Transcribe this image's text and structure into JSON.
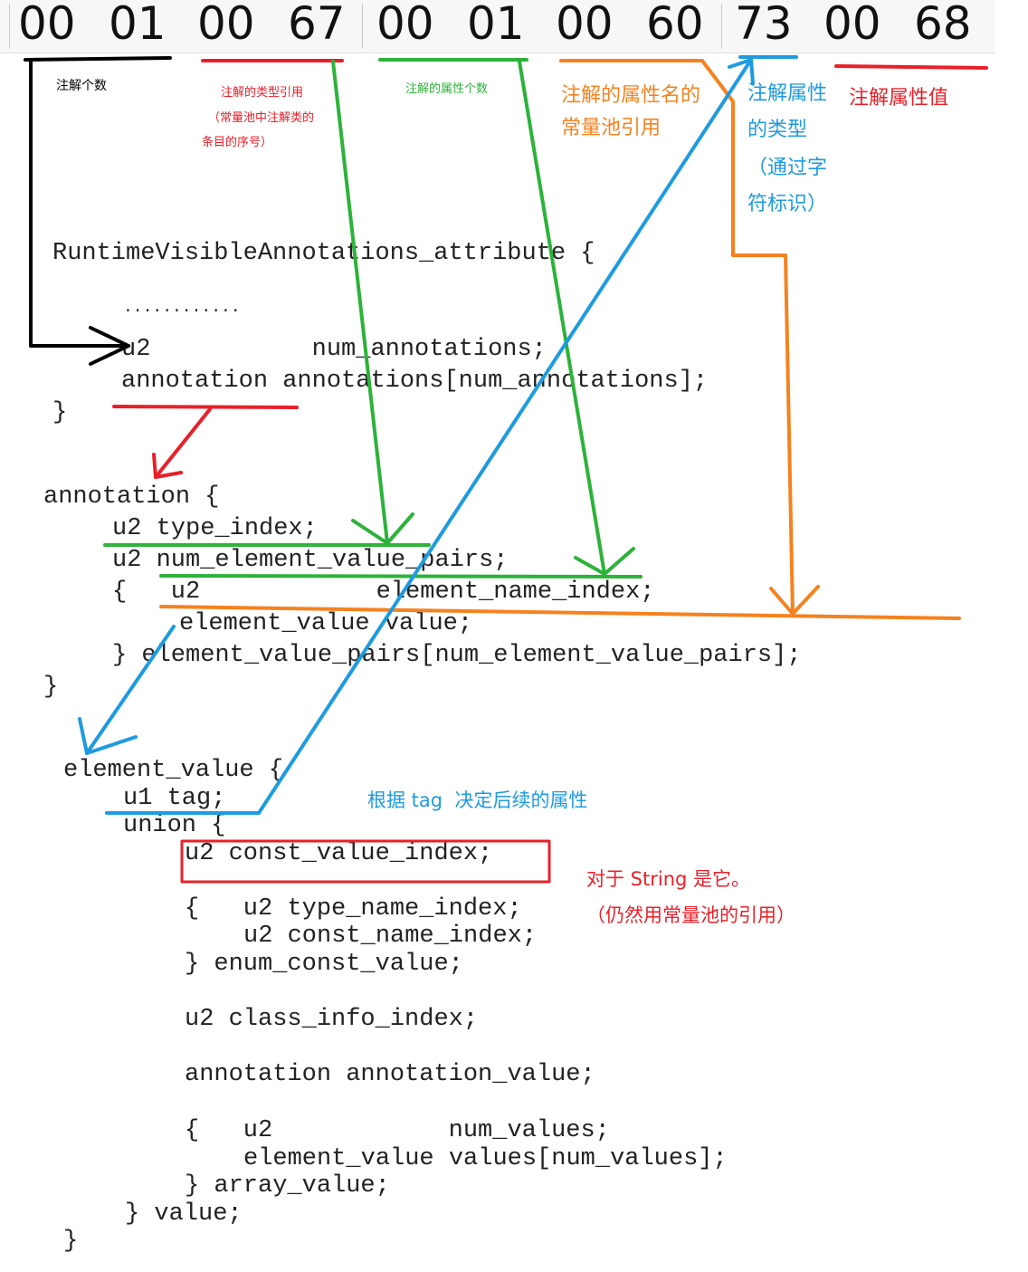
{
  "hex_bytes": [
    "00",
    "01",
    "00",
    "67",
    "00",
    "01",
    "00",
    "60",
    "73",
    "00",
    "68"
  ],
  "labels": {
    "num_annotations": "注解个数",
    "type_ref_line1": "注解的类型引用",
    "type_ref_line2": "（常量池中注解类的",
    "type_ref_line3": "条目的序号）",
    "num_props": "注解的属性个数",
    "prop_name_line1": "注解的属性名的",
    "prop_name_line2": "常量池引用",
    "prop_type_line1": "注解属性",
    "prop_type_line2": "的类型",
    "prop_type_line3": "（通过字",
    "prop_type_line4": "符标识）",
    "prop_value": "注解属性值",
    "tag_note": "根据 tag  决定后续的属性",
    "string_note_line1": "对于 String 是它。",
    "string_note_line2": "（仍然用常量池的引用）"
  },
  "code": {
    "rva_open": "RuntimeVisibleAnnotations_attribute {",
    "rva_dots": "............",
    "rva_num": "u2           num_annotations;",
    "rva_arr": "annotation annotations[num_annotations];",
    "rva_close": "}",
    "ann_open": "annotation {",
    "ann_type": "u2 type_index;",
    "ann_num": "u2 num_element_value_pairs;",
    "ann_pair_open": "{   u2            element_name_index;",
    "ann_pair_val": "element_value value;",
    "ann_pair_close": "} element_value_pairs[num_element_value_pairs];",
    "ann_close": "}",
    "ev_open": "element_value {",
    "ev_tag": "u1 tag;",
    "ev_union": "union {",
    "ev_const": "u2 const_value_index;",
    "ev_enum_open": "{   u2 type_name_index;",
    "ev_enum_const": "u2 const_name_index;",
    "ev_enum_close": "} enum_const_value;",
    "ev_class": "u2 class_info_index;",
    "ev_annval": "annotation annotation_value;",
    "ev_arr_open": "{   u2            num_values;",
    "ev_arr_vals": "element_value values[num_values];",
    "ev_arr_close": "} array_value;",
    "ev_union_close": "} value;",
    "ev_close": "}"
  },
  "colors": {
    "black": "#000000",
    "red": "#e8202a",
    "green": "#2db23a",
    "orange": "#f5821f",
    "blue": "#1e9be0"
  }
}
